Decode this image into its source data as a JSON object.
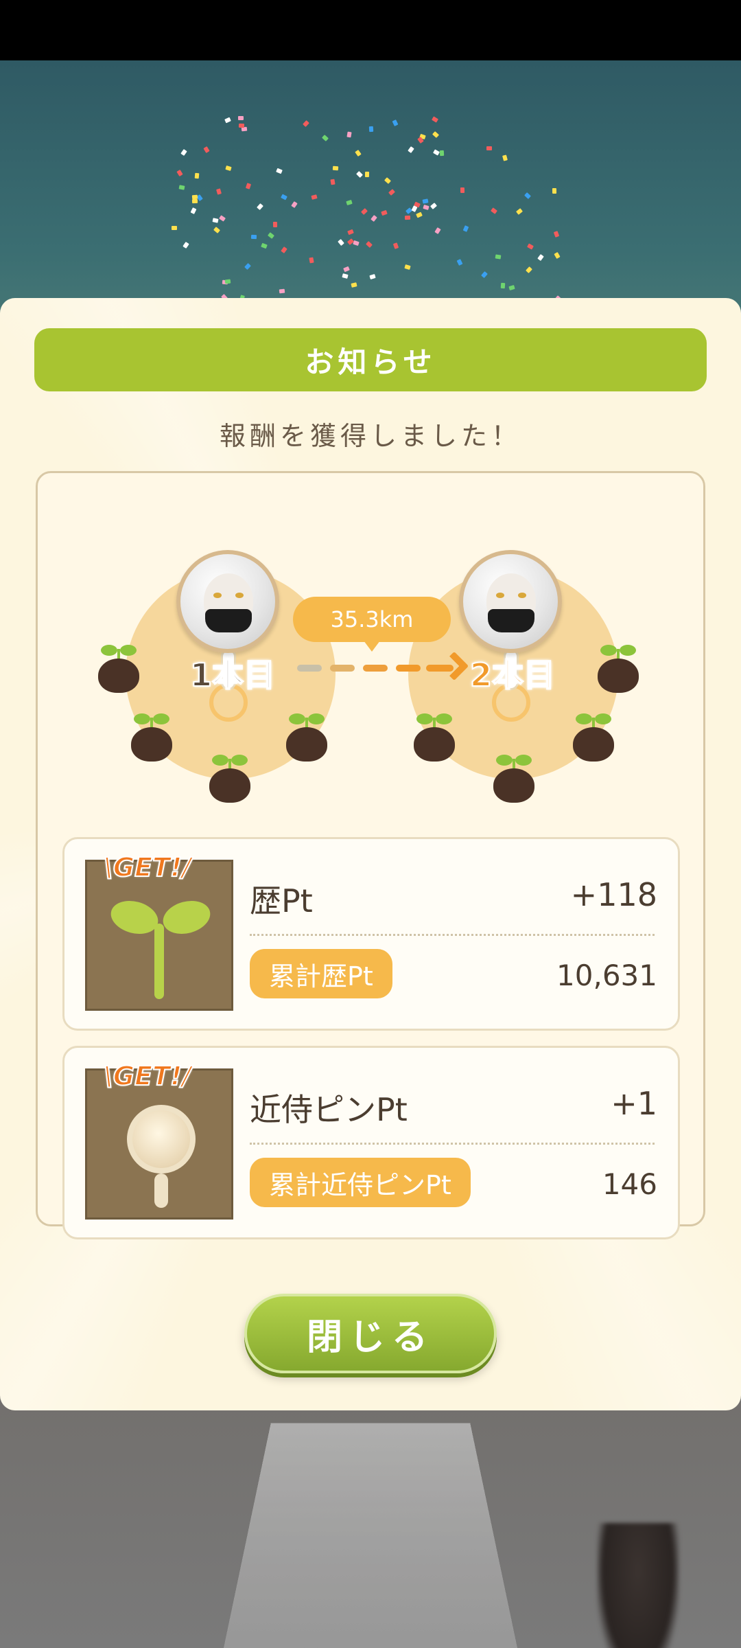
{
  "modal": {
    "title": "お知らせ",
    "subtitle": "報酬を獲得しました！"
  },
  "route": {
    "from_label": "1本目",
    "to_label": "2本目",
    "distance": "35.3km"
  },
  "rewards": [
    {
      "get_text": "\\GET!/",
      "icon": "sprout-icon",
      "name": "歴Pt",
      "value": "+118",
      "total_label": "累計歴Pt",
      "total_value": "10,631"
    },
    {
      "get_text": "\\GET!/",
      "icon": "pin-icon",
      "name": "近侍ピンPt",
      "value": "+1",
      "total_label": "累計近侍ピンPt",
      "total_value": "146"
    }
  ],
  "buttons": {
    "close_label": "閉じる"
  },
  "colors": {
    "title_green": "#a8c431",
    "accent_orange": "#f6b94b",
    "modal_bg": "#fdf6df"
  }
}
